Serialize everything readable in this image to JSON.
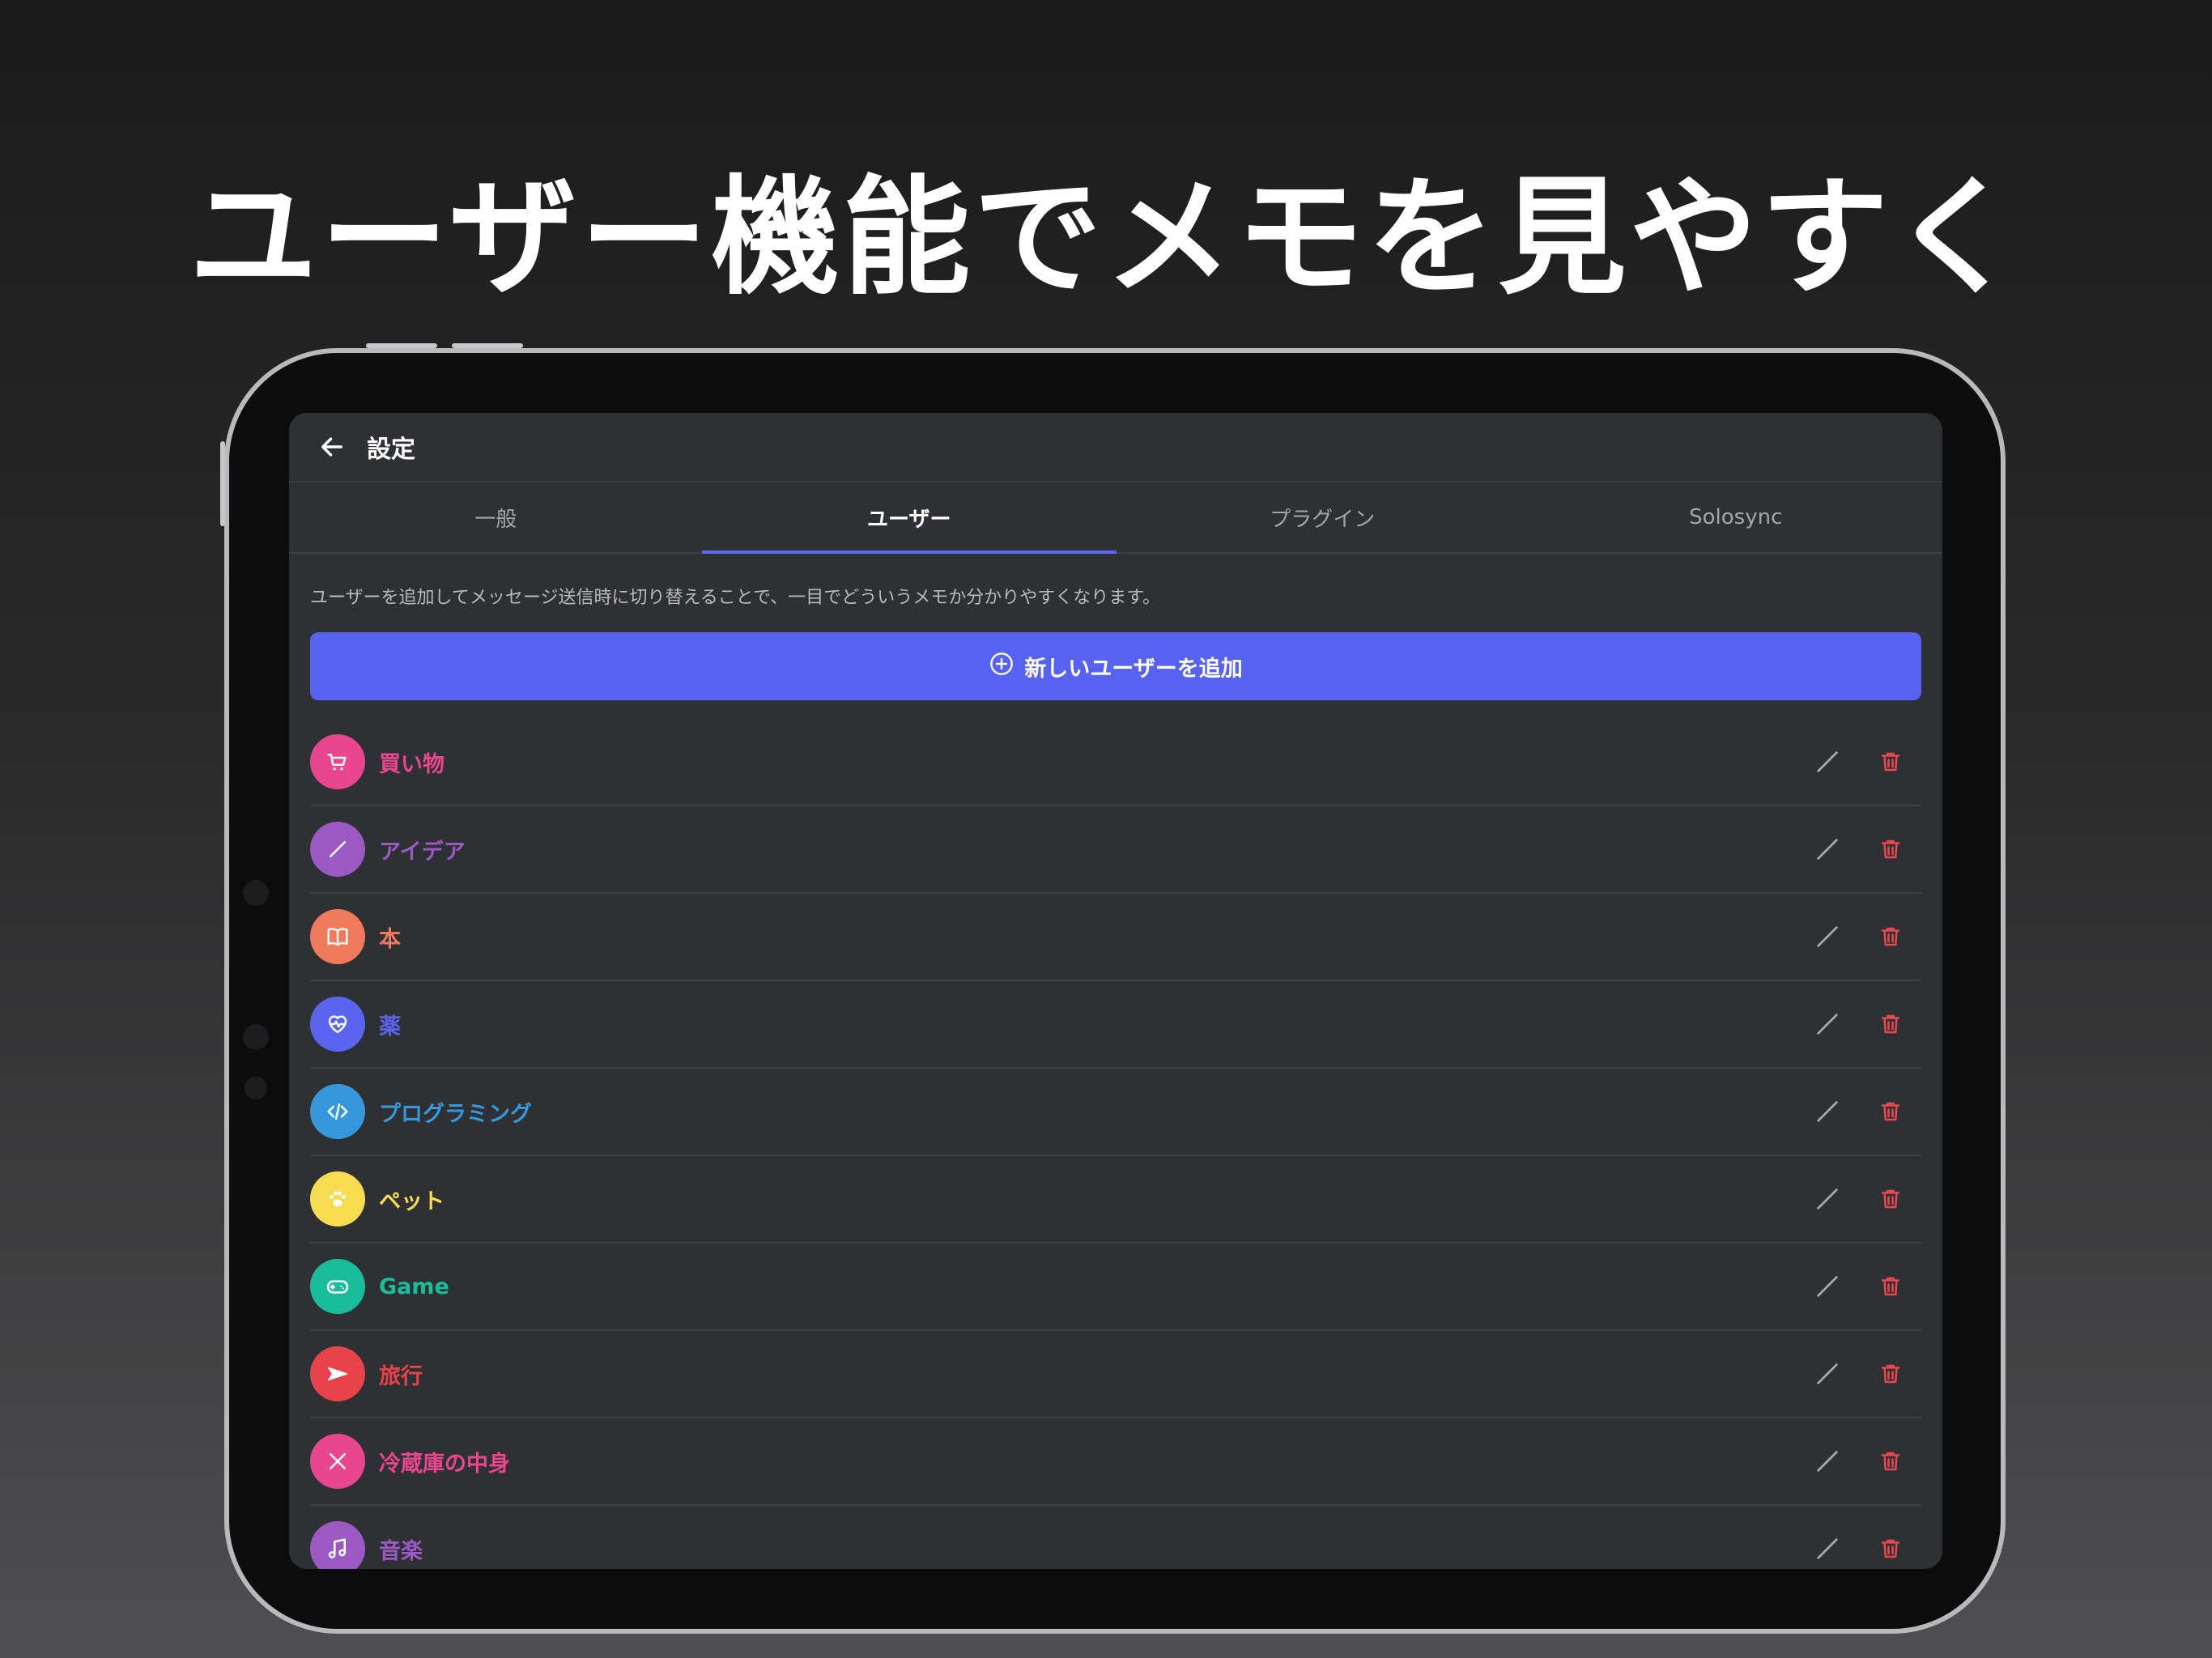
{
  "headline": "ユーザー機能でメモを見やすく",
  "topbar": {
    "title": "設定",
    "back_icon": "arrow-left-icon"
  },
  "tabs": [
    {
      "label": "一般",
      "active": false
    },
    {
      "label": "ユーザー",
      "active": true
    },
    {
      "label": "プラグイン",
      "active": false
    },
    {
      "label": "Solosync",
      "active": false
    }
  ],
  "description": "ユーザーを追加してメッセージ送信時に切り替えることで、一目でどういうメモか分かりやすくなります。",
  "add_button": {
    "label": "新しいユーザーを追加",
    "icon": "plus-circle-icon"
  },
  "users": [
    {
      "name": "買い物",
      "color": "#e8468f",
      "icon": "cart-icon"
    },
    {
      "name": "アイデア",
      "color": "#9b59c4",
      "icon": "pen-icon"
    },
    {
      "name": "本",
      "color": "#ef7a5c",
      "icon": "book-icon"
    },
    {
      "name": "薬",
      "color": "#5a64ee",
      "icon": "heart-pulse-icon"
    },
    {
      "name": "プログラミング",
      "color": "#3498db",
      "icon": "code-icon"
    },
    {
      "name": "ペット",
      "color": "#f7dc4f",
      "icon": "paw-icon"
    },
    {
      "name": "Game",
      "color": "#1abc9c",
      "icon": "gamepad-icon"
    },
    {
      "name": "旅行",
      "color": "#e8434a",
      "icon": "plane-icon"
    },
    {
      "name": "冷蔵庫の中身",
      "color": "#e8468f",
      "icon": "utensils-icon"
    },
    {
      "name": "音楽",
      "color": "#9b59c4",
      "icon": "music-note-icon"
    }
  ],
  "row_actions": {
    "edit_icon": "pencil-icon",
    "delete_icon": "trash-icon",
    "edit_color": "#a4a5aa",
    "delete_color": "#e5484d"
  },
  "colors": {
    "accent": "#5862f0",
    "surface": "#2f3034",
    "background": "#1b1b1b"
  }
}
